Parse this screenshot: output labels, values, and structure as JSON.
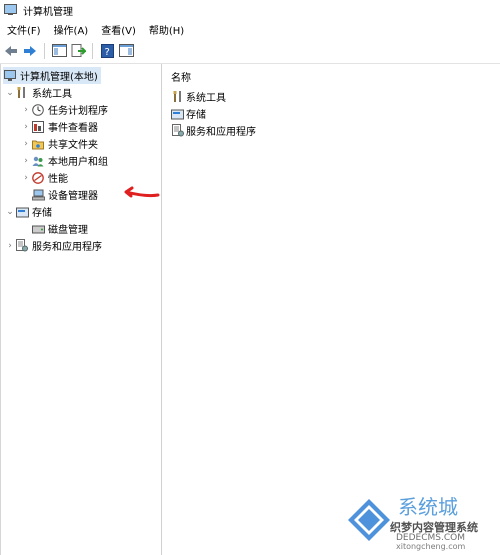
{
  "window": {
    "title": "计算机管理"
  },
  "menu": [
    "文件(F)",
    "操作(A)",
    "查看(V)",
    "帮助(H)"
  ],
  "toolbar": {
    "icons": [
      "back-arrow-icon",
      "forward-arrow-icon",
      "show-tree-icon",
      "export-list-icon",
      "help-icon",
      "show-action-pane-icon"
    ]
  },
  "tree": {
    "root": "计算机管理(本地)",
    "system_tools": "系统工具",
    "task_scheduler": "任务计划程序",
    "event_viewer": "事件查看器",
    "shared_folders": "共享文件夹",
    "local_users_groups": "本地用户和组",
    "performance": "性能",
    "device_manager": "设备管理器",
    "storage": "存储",
    "disk_management": "磁盘管理",
    "services_apps": "服务和应用程序"
  },
  "list": {
    "column_name": "名称",
    "items": [
      "系统工具",
      "存储",
      "服务和应用程序"
    ]
  },
  "watermark": {
    "logo_text": "系统城",
    "site_cn": "织梦内容管理系统",
    "site_en": "DEDECMS.COM",
    "url": "xitongcheng.com"
  },
  "colors": {
    "annotation_arrow": "#e02020",
    "selection": "#d9e8f7"
  }
}
